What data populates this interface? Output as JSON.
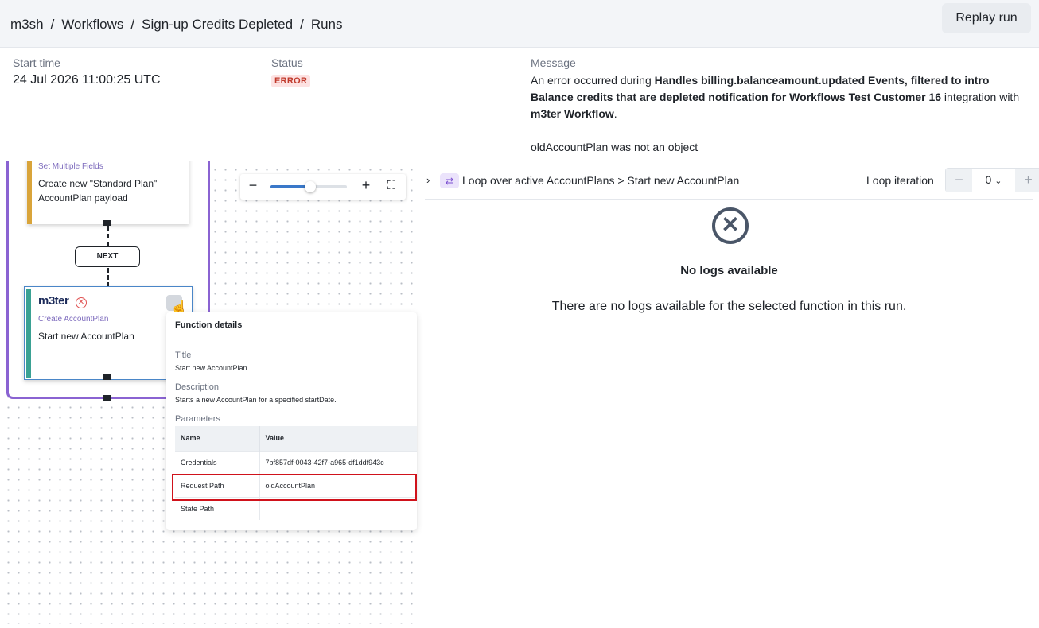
{
  "breadcrumb": [
    "m3sh",
    "Workflows",
    "Sign-up Credits Depleted",
    "Runs"
  ],
  "breadcrumb_separator": "/",
  "replay_label": "Replay run",
  "summary": {
    "start_label": "Start time",
    "start_value": "24 Jul 2026 11:00:25 UTC",
    "status_label": "Status",
    "status_value": "ERROR",
    "message_label": "Message",
    "message_prefix": "An error occurred during ",
    "message_bold1": "Handles billing.balanceamount.updated Events, filtered to intro Balance credits that are depleted notification for Workflows Test Customer 16",
    "message_middle": " integration with ",
    "message_bold2": "m3ter Workflow",
    "message_suffix": ".",
    "message_detail": "oldAccountPlan was not an object"
  },
  "canvas": {
    "node1_type": "Set Multiple Fields",
    "node1_title": "Create new \"Standard Plan\" AccountPlan payload",
    "next_label": "NEXT",
    "node2_logo": "m3ter",
    "node2_type": "Create AccountPlan",
    "node2_title": "Start new AccountPlan",
    "zoom_level": 0.52
  },
  "popup": {
    "heading": "Function details",
    "title_label": "Title",
    "title_value": "Start new AccountPlan",
    "desc_label": "Description",
    "desc_value": "Starts a new AccountPlan for a specified startDate.",
    "params_label": "Parameters",
    "col_name": "Name",
    "col_value": "Value",
    "rows": [
      {
        "name": "Credentials",
        "value": "7bf857df-0043-42f7-a965-df1ddf943c"
      },
      {
        "name": "Request Path",
        "value": "oldAccountPlan"
      },
      {
        "name": "State Path",
        "value": ""
      }
    ]
  },
  "right": {
    "path": "Loop over active AccountPlans > Start new AccountPlan",
    "iteration_label": "Loop iteration",
    "iteration_value": "0",
    "empty_title": "No logs available",
    "empty_desc": "There are no logs available for the selected function in this run."
  }
}
